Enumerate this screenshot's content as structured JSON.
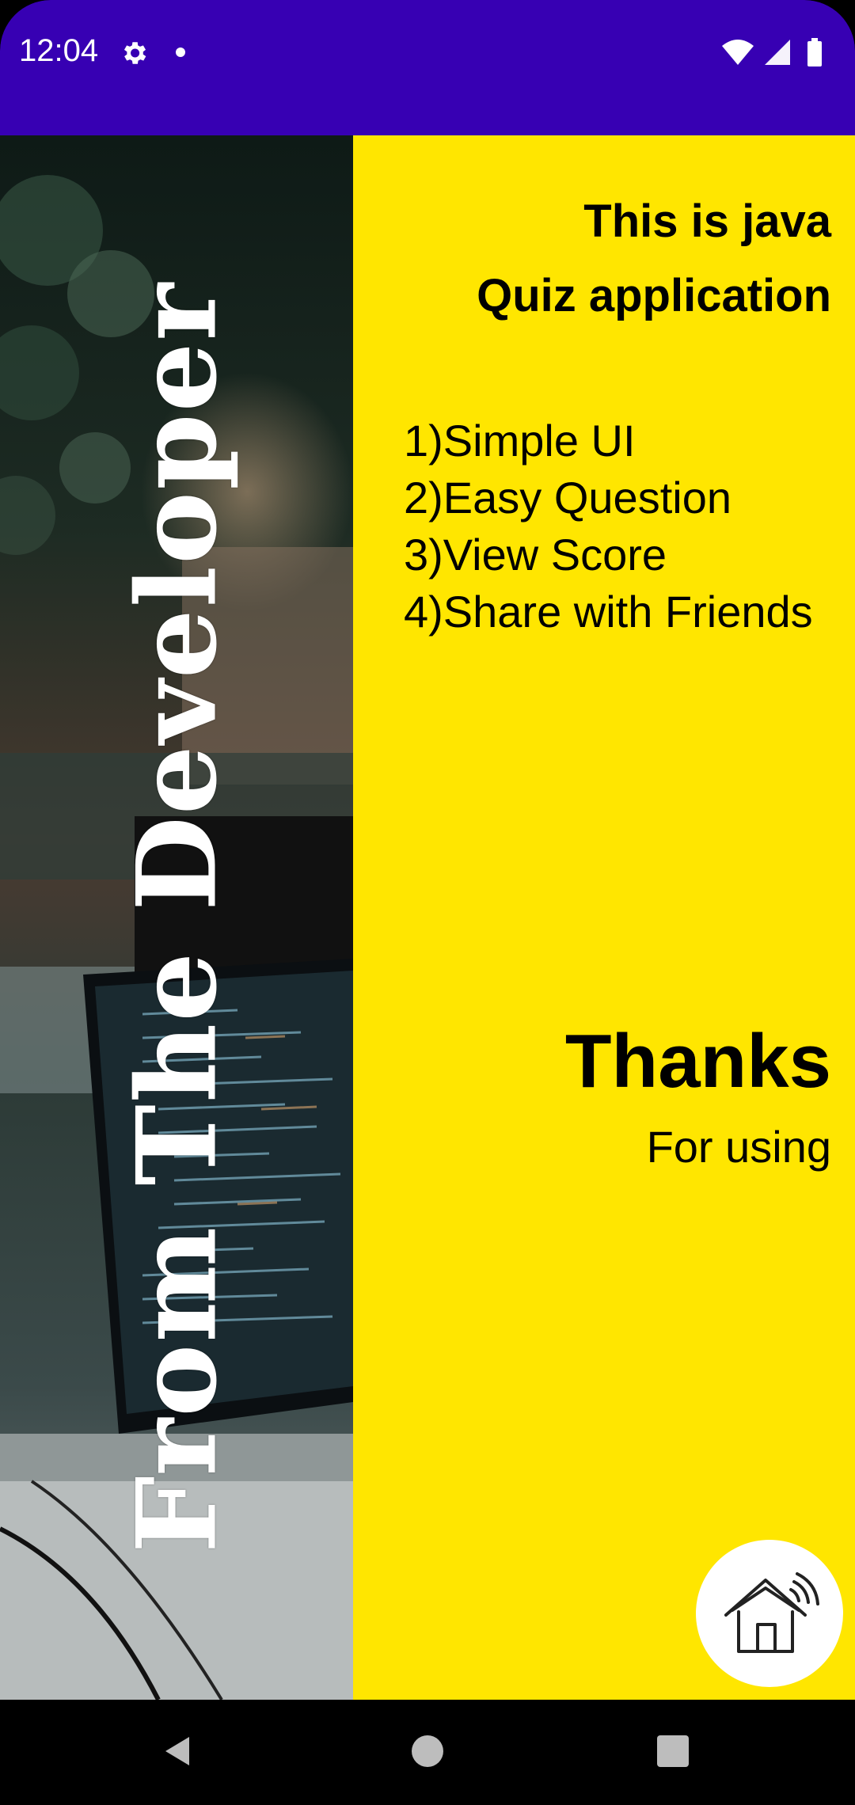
{
  "status_bar": {
    "time": "12:04",
    "icons": [
      "gear-icon",
      "notification-dot",
      "wifi-icon",
      "signal-icon",
      "battery-icon"
    ],
    "background": "#3700B3"
  },
  "left_panel": {
    "title": "From The Developer",
    "background_image": "developer-desk-photo"
  },
  "right_panel": {
    "background": "#FFE600",
    "intro_line1": "This is java",
    "intro_line2": "Quiz application",
    "features": [
      "1)Simple UI",
      "2)Easy Question",
      "3)View Score",
      "4)Share with Friends"
    ],
    "thanks": "Thanks",
    "for_using": "For using",
    "home_button_icon": "smart-home-icon"
  },
  "nav_bar": {
    "buttons": [
      "back-icon",
      "home-circle-icon",
      "recents-square-icon"
    ]
  }
}
